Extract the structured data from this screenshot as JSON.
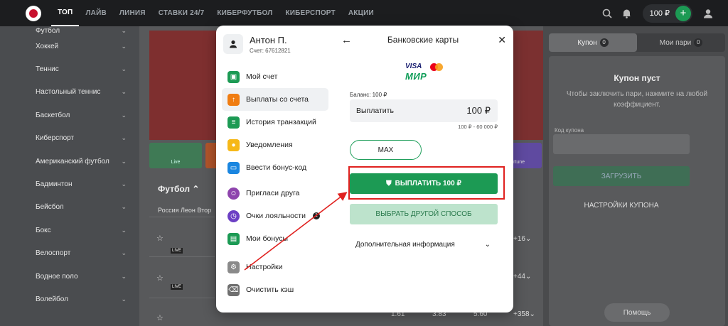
{
  "nav": {
    "items": [
      "ТОП",
      "ЛАЙВ",
      "ЛИНИЯ",
      "СТАВКИ 24/7",
      "КИБЕРФУТБОЛ",
      "КИБЕРСПОРТ",
      "АКЦИИ"
    ],
    "balance": "100 ₽"
  },
  "sidebar": {
    "sports": [
      "Футбол",
      "Хоккей",
      "Теннис",
      "Настольный теннис",
      "Баскетбол",
      "Киберспорт",
      "Американский футбол",
      "Бадминтон",
      "Бейсбол",
      "Бокс",
      "Велоспорт",
      "Водное поло",
      "Волейбол"
    ]
  },
  "main": {
    "section_title": "Футбол",
    "country": "Россия Леон Втор",
    "tile_live": "Live",
    "tile_fortune": "Fortune",
    "odds": [
      "1.61",
      "3.83",
      "5.60"
    ],
    "more": [
      "+16",
      "+44",
      "+358"
    ]
  },
  "coupon": {
    "tabs": [
      {
        "label": "Купон",
        "count": "0"
      },
      {
        "label": "Мои пари",
        "count": "0"
      }
    ],
    "empty_title": "Купон пуст",
    "empty_text": "Чтобы заключить пари, нажмите на любой коэффициент.",
    "code_label": "Код купона",
    "load_label": "ЗАГРУЗИТЬ",
    "settings_label": "НАСТРОЙКИ КУПОНА",
    "help_label": "Помощь"
  },
  "modal": {
    "user_name": "Антон П.",
    "account": "Счет: 67612821",
    "menu": [
      {
        "label": "Мой счет",
        "icon": "wallet-icon",
        "color": "#1c9a54"
      },
      {
        "label": "Выплаты со счета",
        "icon": "upload-icon",
        "color": "#f07d12"
      },
      {
        "label": "История транзакций",
        "icon": "history-icon",
        "color": "#1c9a54"
      },
      {
        "label": "Уведомления",
        "icon": "bell-icon",
        "color": "#f6b818"
      },
      {
        "label": "Ввести бонус-код",
        "icon": "ticket-icon",
        "color": "#1a86e0"
      },
      {
        "label": "Пригласи друга",
        "icon": "smile-icon",
        "color": "#8e44ad"
      },
      {
        "label": "Очки лояльности",
        "icon": "clock-icon",
        "color": "#6c3fc4"
      },
      {
        "label": "Мои бонусы",
        "icon": "gift-icon",
        "color": "#1c9a54"
      },
      {
        "label": "Настройки",
        "icon": "gear-icon",
        "color": "#8a8a8a"
      },
      {
        "label": "Очистить кэш",
        "icon": "broom-icon",
        "color": "#6f6f6f"
      }
    ],
    "loyalty_count": "1",
    "title": "Банковские карты",
    "visa": "VISA",
    "mir": "МИР",
    "balance_label": "Баланс: 100 ₽",
    "amount_label": "Выплатить",
    "amount_value": "100 ₽",
    "range": "100 ₽ - 60 000 ₽",
    "max_label": "MAX",
    "pay_label": "ВЫПЛАТИТЬ 100 ₽",
    "alt_label": "ВЫБРАТЬ ДРУГОЙ СПОСОБ",
    "info_label": "Дополнительная информация"
  },
  "colors": {
    "accent_green": "#1c9a54",
    "highlight_red": "#e0211f"
  }
}
